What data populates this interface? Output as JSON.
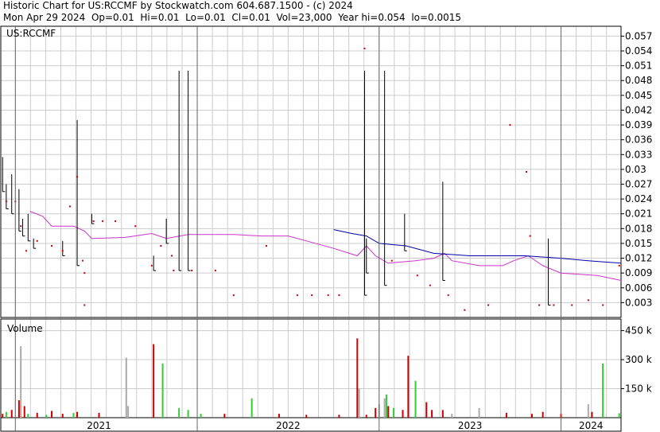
{
  "header": {
    "line1": "Historic Chart for US:RCCMF by Stockwatch.com 604.687.1500 - (c) 2024",
    "line2": "Mon Apr 29 2024  Op=0.01  Hi=0.01  Lo=0.01  Cl=0.01  Vol=23,000  Year hi=0.054  lo=0.0015"
  },
  "colors": {
    "up_volume": "#33cc33",
    "down_volume": "#cc0000",
    "flat_volume": "#aaaaaa",
    "ma_short": "#cc33cc",
    "ma_long": "#0000aa",
    "price_bar": "#000000",
    "price_dot": "#cc0000",
    "grid": "#cccccc"
  },
  "chart_data": [
    {
      "type": "ohlc",
      "panel": "price",
      "legend": "US:RCCMF",
      "ylim": [
        0,
        0.059
      ],
      "y_ticks": [
        0.003,
        0.006,
        0.009,
        0.012,
        0.015,
        0.018,
        0.021,
        0.024,
        0.027,
        0.03,
        0.033,
        0.036,
        0.039,
        0.042,
        0.045,
        0.048,
        0.051,
        0.054,
        0.057
      ],
      "y_tick_labels": [
        "0.003",
        "0.006",
        "0.009",
        "0.012",
        "0.015",
        "0.018",
        "0.021",
        "0.024",
        "0.027",
        "0.03",
        "0.033",
        "0.036",
        "0.039",
        "0.042",
        "0.045",
        "0.048",
        "0.051",
        "0.054",
        "0.057"
      ],
      "x_range_years": [
        2020.92,
        2024.33
      ],
      "x_labels": [
        {
          "label": "2021",
          "year": 2021.0
        },
        {
          "label": "2022",
          "year": 2022.0
        },
        {
          "label": "2023",
          "year": 2023.0
        },
        {
          "label": "2024",
          "year": 2024.0
        }
      ],
      "range_bars": [
        {
          "t": 2020.93,
          "lo": 0.0255,
          "hi": 0.0325
        },
        {
          "t": 2020.95,
          "lo": 0.022,
          "hi": 0.027
        },
        {
          "t": 2020.98,
          "lo": 0.021,
          "hi": 0.029
        },
        {
          "t": 2021.02,
          "lo": 0.0175,
          "hi": 0.026
        },
        {
          "t": 2021.04,
          "lo": 0.0165,
          "hi": 0.02
        },
        {
          "t": 2021.07,
          "lo": 0.0155,
          "hi": 0.021
        },
        {
          "t": 2021.1,
          "lo": 0.014,
          "hi": 0.016
        },
        {
          "t": 2021.26,
          "lo": 0.0125,
          "hi": 0.0155
        },
        {
          "t": 2021.34,
          "lo": 0.0105,
          "hi": 0.04
        },
        {
          "t": 2021.42,
          "lo": 0.019,
          "hi": 0.021
        },
        {
          "t": 2021.76,
          "lo": 0.0095,
          "hi": 0.0125
        },
        {
          "t": 2021.83,
          "lo": 0.015,
          "hi": 0.02
        },
        {
          "t": 2021.9,
          "lo": 0.0095,
          "hi": 0.05
        },
        {
          "t": 2021.95,
          "lo": 0.0095,
          "hi": 0.05
        },
        {
          "t": 2022.92,
          "lo": 0.0045,
          "hi": 0.05
        },
        {
          "t": 2022.93,
          "lo": 0.009,
          "hi": 0.016
        },
        {
          "t": 2023.03,
          "lo": 0.0065,
          "hi": 0.05
        },
        {
          "t": 2023.14,
          "lo": 0.0135,
          "hi": 0.021
        },
        {
          "t": 2023.35,
          "lo": 0.0075,
          "hi": 0.0275
        },
        {
          "t": 2023.93,
          "lo": 0.0025,
          "hi": 0.016
        }
      ],
      "close_points": [
        {
          "t": 2020.95,
          "v": 0.0235
        },
        {
          "t": 2021.0,
          "v": 0.0235
        },
        {
          "t": 2021.03,
          "v": 0.0185
        },
        {
          "t": 2021.06,
          "v": 0.0135
        },
        {
          "t": 2021.12,
          "v": 0.0155
        },
        {
          "t": 2021.2,
          "v": 0.0145
        },
        {
          "t": 2021.26,
          "v": 0.0135
        },
        {
          "t": 2021.3,
          "v": 0.0225
        },
        {
          "t": 2021.34,
          "v": 0.0285
        },
        {
          "t": 2021.37,
          "v": 0.0115
        },
        {
          "t": 2021.38,
          "v": 0.009
        },
        {
          "t": 2021.38,
          "v": 0.0025
        },
        {
          "t": 2021.43,
          "v": 0.0195
        },
        {
          "t": 2021.48,
          "v": 0.0195
        },
        {
          "t": 2021.55,
          "v": 0.0195
        },
        {
          "t": 2021.66,
          "v": 0.0185
        },
        {
          "t": 2021.75,
          "v": 0.0105
        },
        {
          "t": 2021.8,
          "v": 0.0145
        },
        {
          "t": 2021.86,
          "v": 0.0125
        },
        {
          "t": 2021.87,
          "v": 0.0095
        },
        {
          "t": 2021.97,
          "v": 0.0095
        },
        {
          "t": 2022.1,
          "v": 0.0095
        },
        {
          "t": 2022.2,
          "v": 0.0045
        },
        {
          "t": 2022.38,
          "v": 0.0145
        },
        {
          "t": 2022.55,
          "v": 0.0045
        },
        {
          "t": 2022.63,
          "v": 0.0045
        },
        {
          "t": 2022.72,
          "v": 0.0045
        },
        {
          "t": 2022.78,
          "v": 0.0045
        },
        {
          "t": 2022.92,
          "v": 0.0545
        },
        {
          "t": 2023.07,
          "v": 0.0115
        },
        {
          "t": 2023.21,
          "v": 0.0085
        },
        {
          "t": 2023.28,
          "v": 0.0065
        },
        {
          "t": 2023.38,
          "v": 0.0045
        },
        {
          "t": 2023.47,
          "v": 0.0015
        },
        {
          "t": 2023.6,
          "v": 0.0025
        },
        {
          "t": 2023.72,
          "v": 0.039
        },
        {
          "t": 2023.81,
          "v": 0.0295
        },
        {
          "t": 2023.83,
          "v": 0.0165
        },
        {
          "t": 2023.88,
          "v": 0.0025
        },
        {
          "t": 2023.96,
          "v": 0.0025
        },
        {
          "t": 2024.06,
          "v": 0.0025
        },
        {
          "t": 2024.15,
          "v": 0.0035
        },
        {
          "t": 2024.23,
          "v": 0.0025
        },
        {
          "t": 2024.32,
          "v": 0.0105
        }
      ],
      "series": [
        {
          "color_key": "ma_short",
          "points": [
            {
              "t": 2021.08,
              "v": 0.0215
            },
            {
              "t": 2021.15,
              "v": 0.0205
            },
            {
              "t": 2021.2,
              "v": 0.0185
            },
            {
              "t": 2021.32,
              "v": 0.0185
            },
            {
              "t": 2021.38,
              "v": 0.0175
            },
            {
              "t": 2021.42,
              "v": 0.016
            },
            {
              "t": 2021.6,
              "v": 0.0162
            },
            {
              "t": 2021.75,
              "v": 0.017
            },
            {
              "t": 2021.83,
              "v": 0.016
            },
            {
              "t": 2021.95,
              "v": 0.0168
            },
            {
              "t": 2022.2,
              "v": 0.0168
            },
            {
              "t": 2022.35,
              "v": 0.0165
            },
            {
              "t": 2022.5,
              "v": 0.0165
            },
            {
              "t": 2022.6,
              "v": 0.0155
            },
            {
              "t": 2022.75,
              "v": 0.014
            },
            {
              "t": 2022.88,
              "v": 0.0125
            },
            {
              "t": 2022.93,
              "v": 0.0145
            },
            {
              "t": 2022.98,
              "v": 0.0125
            },
            {
              "t": 2023.05,
              "v": 0.011
            },
            {
              "t": 2023.2,
              "v": 0.0115
            },
            {
              "t": 2023.3,
              "v": 0.012
            },
            {
              "t": 2023.36,
              "v": 0.013
            },
            {
              "t": 2023.4,
              "v": 0.0115
            },
            {
              "t": 2023.55,
              "v": 0.0105
            },
            {
              "t": 2023.68,
              "v": 0.0105
            },
            {
              "t": 2023.74,
              "v": 0.0115
            },
            {
              "t": 2023.82,
              "v": 0.0125
            },
            {
              "t": 2023.9,
              "v": 0.0105
            },
            {
              "t": 2024.0,
              "v": 0.009
            },
            {
              "t": 2024.2,
              "v": 0.0085
            },
            {
              "t": 2024.33,
              "v": 0.0075
            }
          ]
        },
        {
          "color_key": "ma_long",
          "points": [
            {
              "t": 2022.75,
              "v": 0.0178
            },
            {
              "t": 2022.85,
              "v": 0.017
            },
            {
              "t": 2022.93,
              "v": 0.0165
            },
            {
              "t": 2023.0,
              "v": 0.015
            },
            {
              "t": 2023.15,
              "v": 0.0145
            },
            {
              "t": 2023.3,
              "v": 0.013
            },
            {
              "t": 2023.5,
              "v": 0.0125
            },
            {
              "t": 2023.65,
              "v": 0.0125
            },
            {
              "t": 2023.8,
              "v": 0.0125
            },
            {
              "t": 2024.0,
              "v": 0.012
            },
            {
              "t": 2024.15,
              "v": 0.0115
            },
            {
              "t": 2024.33,
              "v": 0.011
            }
          ]
        }
      ]
    },
    {
      "type": "bar",
      "panel": "volume",
      "title": "Volume",
      "ylim": [
        0,
        510
      ],
      "y_ticks": [
        150,
        300,
        450
      ],
      "y_tick_labels": [
        "150 k",
        "300 k",
        "450 k"
      ],
      "bars": [
        {
          "t": 2020.93,
          "v": 20,
          "c": "down"
        },
        {
          "t": 2020.95,
          "v": 30,
          "c": "up"
        },
        {
          "t": 2020.98,
          "v": 40,
          "c": "down"
        },
        {
          "t": 2021.02,
          "v": 90,
          "c": "down"
        },
        {
          "t": 2021.03,
          "v": 370,
          "c": "flat"
        },
        {
          "t": 2021.05,
          "v": 60,
          "c": "down"
        },
        {
          "t": 2021.07,
          "v": 20,
          "c": "up"
        },
        {
          "t": 2021.12,
          "v": 25,
          "c": "down"
        },
        {
          "t": 2021.17,
          "v": 15,
          "c": "up"
        },
        {
          "t": 2021.2,
          "v": 35,
          "c": "down"
        },
        {
          "t": 2021.26,
          "v": 20,
          "c": "down"
        },
        {
          "t": 2021.32,
          "v": 25,
          "c": "up"
        },
        {
          "t": 2021.34,
          "v": 30,
          "c": "down"
        },
        {
          "t": 2021.46,
          "v": 25,
          "c": "down"
        },
        {
          "t": 2021.61,
          "v": 310,
          "c": "flat"
        },
        {
          "t": 2021.62,
          "v": 60,
          "c": "flat"
        },
        {
          "t": 2021.76,
          "v": 380,
          "c": "down"
        },
        {
          "t": 2021.81,
          "v": 280,
          "c": "up"
        },
        {
          "t": 2021.9,
          "v": 50,
          "c": "up"
        },
        {
          "t": 2021.95,
          "v": 40,
          "c": "up"
        },
        {
          "t": 2022.02,
          "v": 20,
          "c": "up"
        },
        {
          "t": 2022.15,
          "v": 20,
          "c": "down"
        },
        {
          "t": 2022.3,
          "v": 100,
          "c": "up"
        },
        {
          "t": 2022.45,
          "v": 20,
          "c": "down"
        },
        {
          "t": 2022.6,
          "v": 15,
          "c": "down"
        },
        {
          "t": 2022.78,
          "v": 15,
          "c": "down"
        },
        {
          "t": 2022.88,
          "v": 410,
          "c": "down"
        },
        {
          "t": 2022.89,
          "v": 150,
          "c": "flat"
        },
        {
          "t": 2022.93,
          "v": 15,
          "c": "down"
        },
        {
          "t": 2022.98,
          "v": 50,
          "c": "down"
        },
        {
          "t": 2023.0,
          "v": 70,
          "c": "flat"
        },
        {
          "t": 2023.03,
          "v": 100,
          "c": "flat"
        },
        {
          "t": 2023.04,
          "v": 120,
          "c": "up"
        },
        {
          "t": 2023.05,
          "v": 60,
          "c": "down"
        },
        {
          "t": 2023.08,
          "v": 50,
          "c": "up"
        },
        {
          "t": 2023.13,
          "v": 40,
          "c": "down"
        },
        {
          "t": 2023.16,
          "v": 320,
          "c": "down"
        },
        {
          "t": 2023.2,
          "v": 190,
          "c": "up"
        },
        {
          "t": 2023.26,
          "v": 80,
          "c": "down"
        },
        {
          "t": 2023.29,
          "v": 40,
          "c": "down"
        },
        {
          "t": 2023.35,
          "v": 40,
          "c": "down"
        },
        {
          "t": 2023.4,
          "v": 20,
          "c": "flat"
        },
        {
          "t": 2023.55,
          "v": 50,
          "c": "flat"
        },
        {
          "t": 2023.7,
          "v": 25,
          "c": "down"
        },
        {
          "t": 2023.84,
          "v": 20,
          "c": "down"
        },
        {
          "t": 2023.9,
          "v": 30,
          "c": "down"
        },
        {
          "t": 2024.0,
          "v": 20,
          "c": "down"
        },
        {
          "t": 2024.15,
          "v": 70,
          "c": "flat"
        },
        {
          "t": 2024.17,
          "v": 30,
          "c": "down"
        },
        {
          "t": 2024.23,
          "v": 280,
          "c": "up"
        },
        {
          "t": 2024.32,
          "v": 23,
          "c": "up"
        }
      ]
    }
  ]
}
